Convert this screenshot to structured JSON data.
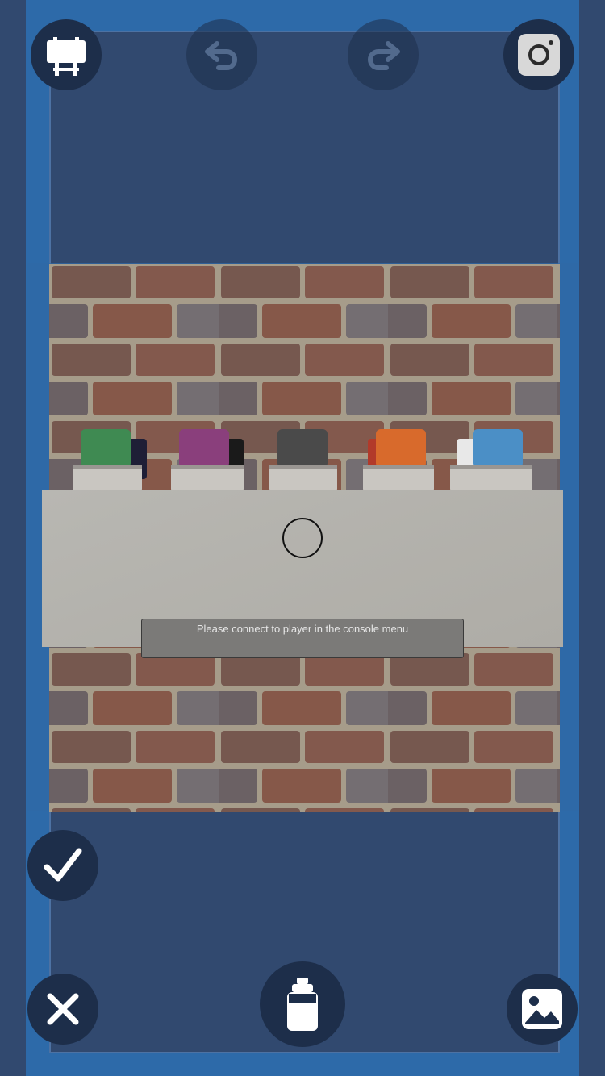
{
  "toolbar": {
    "easel_icon": "easel-icon",
    "undo_icon": "undo-icon",
    "redo_icon": "redo-icon",
    "instagram_icon": "instagram-icon"
  },
  "canvas": {
    "texture": "brick-wall"
  },
  "spray_cans": [
    {
      "cap_color": "#3f8a52",
      "name": "green-can"
    },
    {
      "cap_color": "#8a3f7c",
      "name": "purple-can"
    },
    {
      "cap_color": "#4a4a4a",
      "name": "grey-can"
    },
    {
      "cap_color": "#d86a2c",
      "name": "orange-can"
    },
    {
      "cap_color": "#4b8fc6",
      "name": "blue-can"
    }
  ],
  "status": {
    "message": "Please connect to player in the console menu"
  },
  "bottom_controls": {
    "confirm_icon": "checkmark-icon",
    "cancel_icon": "close-icon",
    "spray_icon": "spray-can-icon",
    "gallery_icon": "image-icon"
  }
}
